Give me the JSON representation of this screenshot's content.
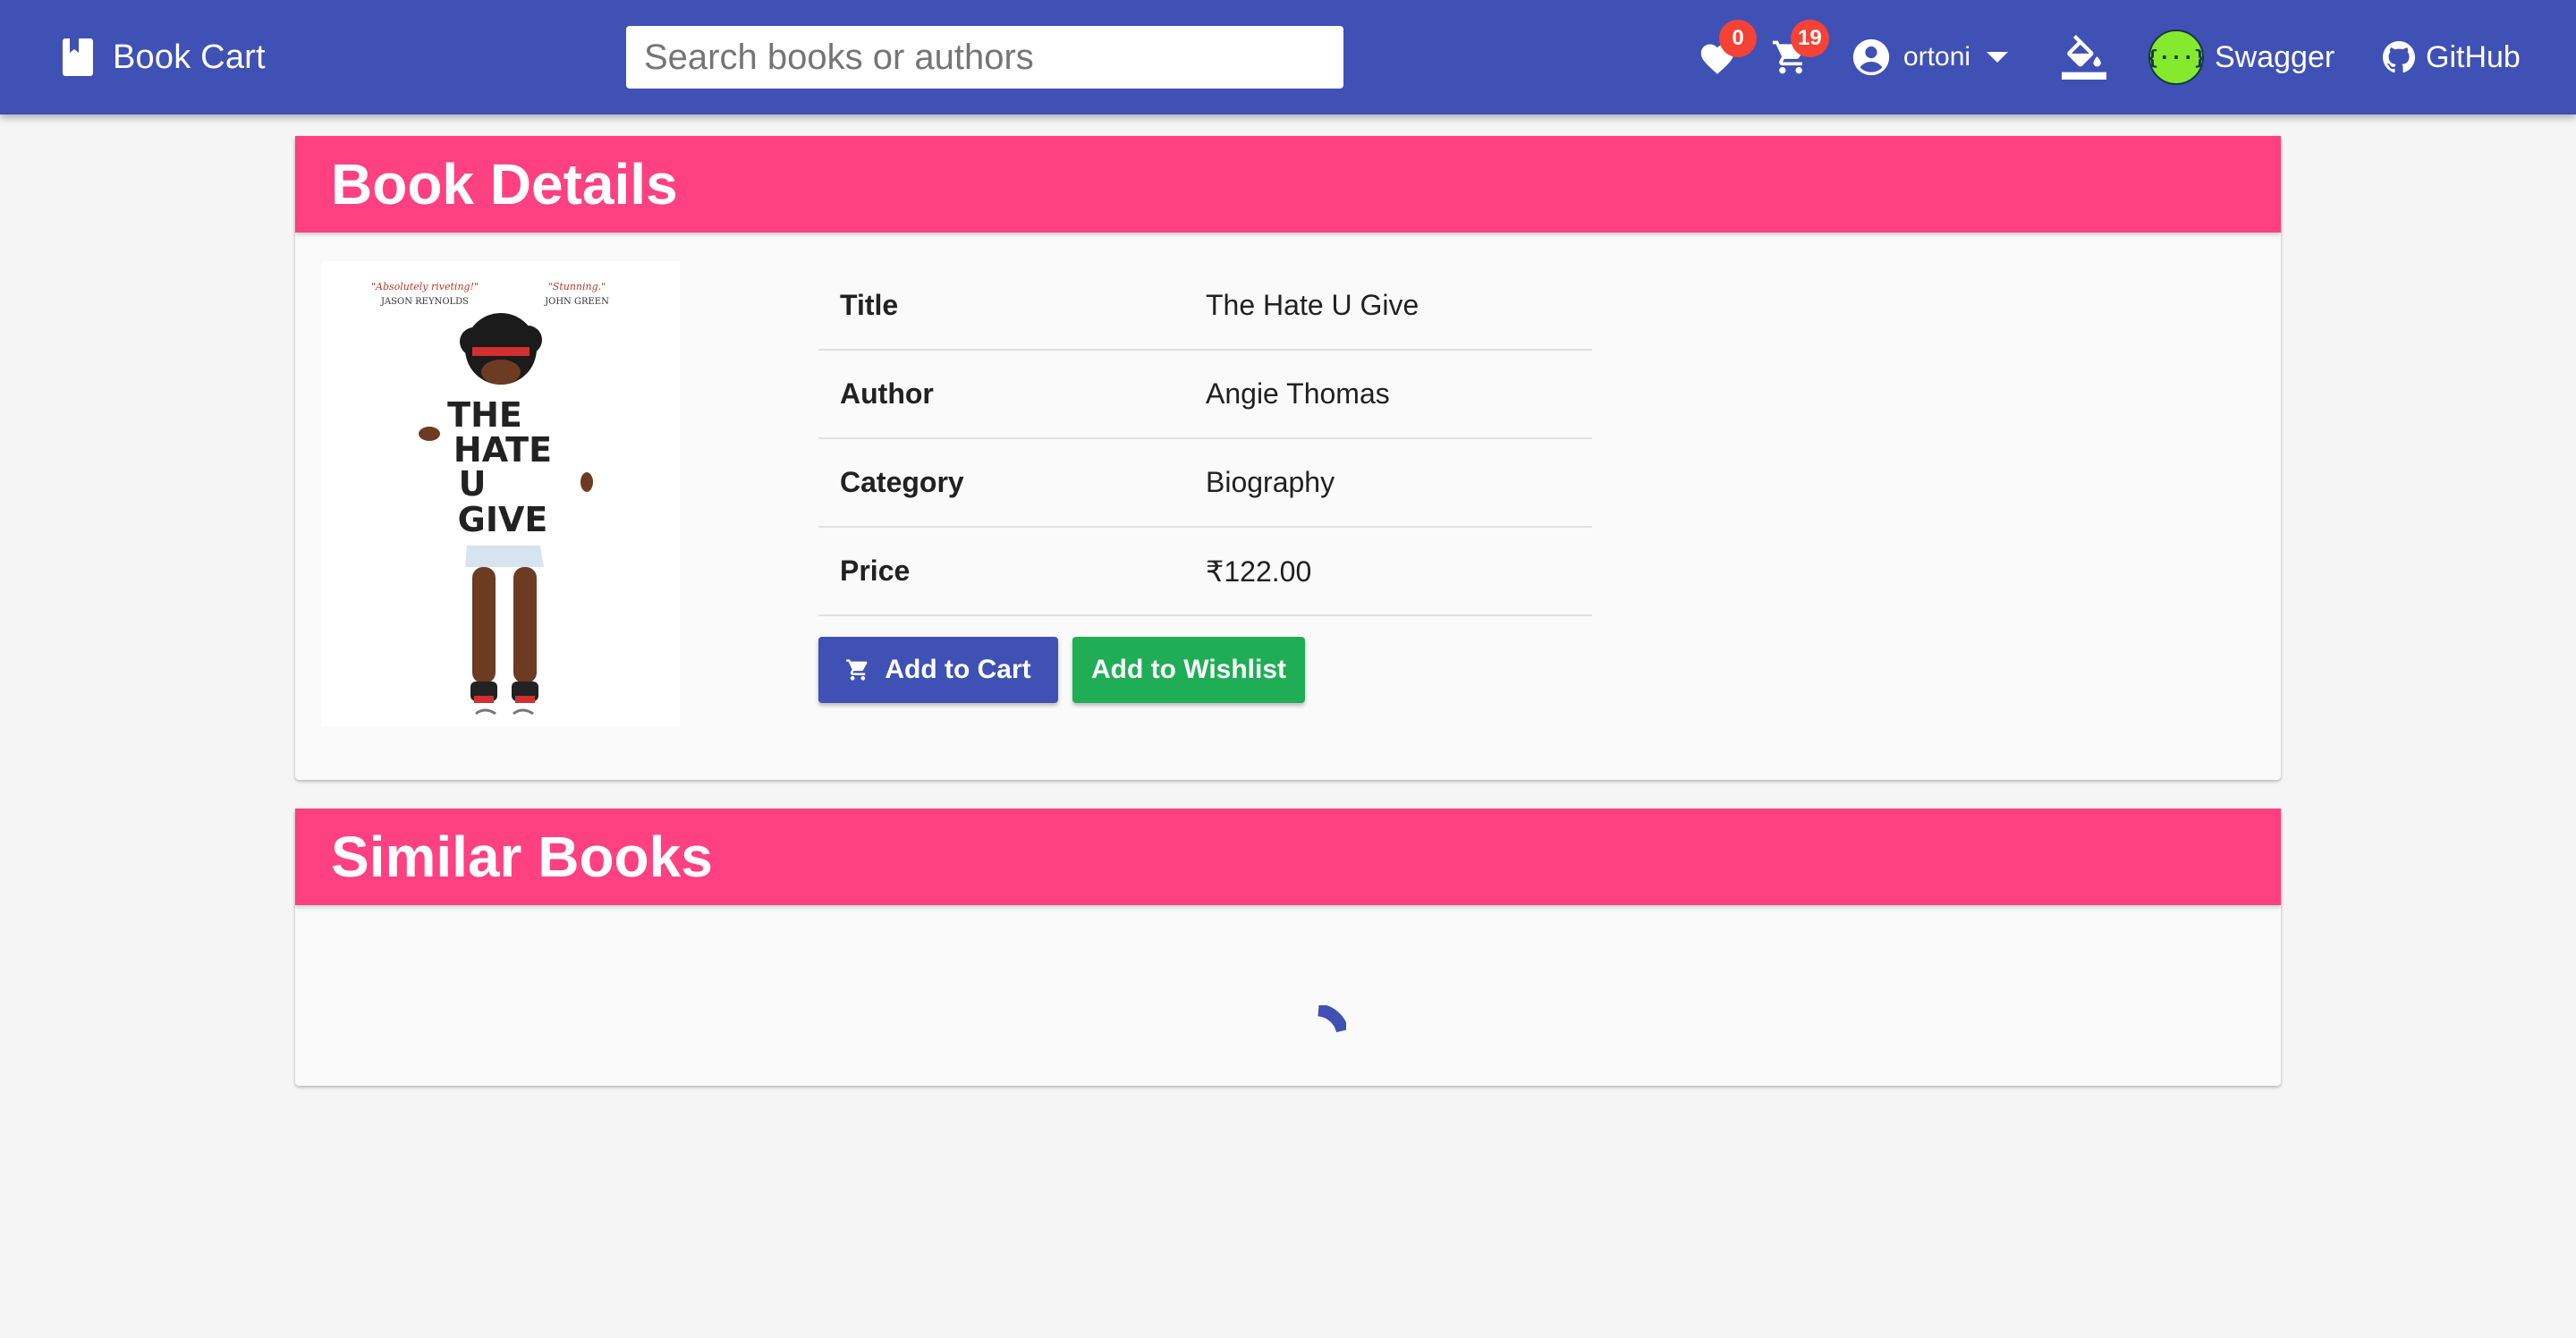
{
  "app": {
    "brand": "Book Cart"
  },
  "search": {
    "placeholder": "Search books or authors"
  },
  "header": {
    "wishlist_count": "0",
    "cart_count": "19",
    "user_name": "ortoni",
    "swagger_label": "Swagger",
    "github_label": "GitHub"
  },
  "book_details": {
    "heading": "Book Details",
    "rows": [
      {
        "label": "Title",
        "value": "The Hate U Give"
      },
      {
        "label": "Author",
        "value": "Angie Thomas"
      },
      {
        "label": "Category",
        "value": "Biography"
      },
      {
        "label": "Price",
        "value": "₹122.00"
      }
    ],
    "add_to_cart_label": "Add to Cart",
    "add_to_wishlist_label": "Add to Wishlist"
  },
  "cover": {
    "blurb_left": "\"Absolutely riveting!\"",
    "blurb_left_author": "JASON REYNOLDS",
    "blurb_right": "\"Stunning.\"",
    "blurb_right_author": "JOHN GREEN",
    "title_lines": [
      "THE",
      "HATE",
      "U",
      "GIVE"
    ]
  },
  "similar_books": {
    "heading": "Similar Books"
  },
  "colors": {
    "primary": "#3f51b5",
    "accent": "#ff4081",
    "success": "#1fae55",
    "badge": "#f44336"
  }
}
